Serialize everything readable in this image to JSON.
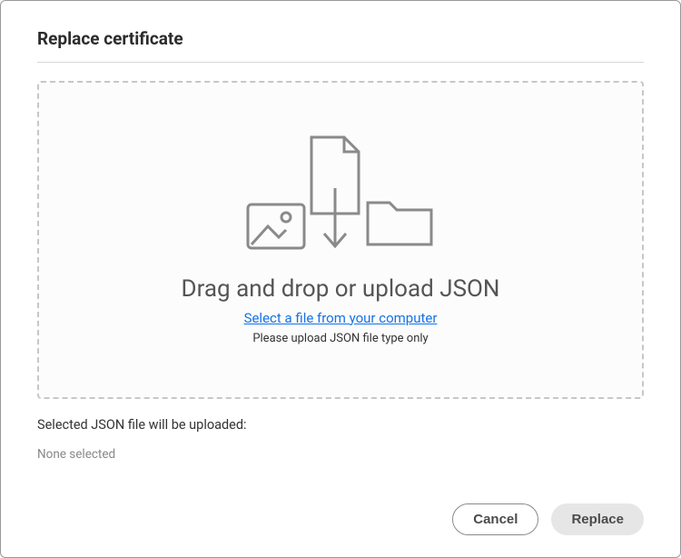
{
  "dialog": {
    "title": "Replace certificate"
  },
  "dropzone": {
    "heading": "Drag and drop or upload JSON",
    "link_text": "Select a file from your computer",
    "hint": "Please upload JSON file type only"
  },
  "selected": {
    "label": "Selected JSON file will be uploaded:",
    "value": "None selected"
  },
  "buttons": {
    "cancel": "Cancel",
    "replace": "Replace"
  }
}
